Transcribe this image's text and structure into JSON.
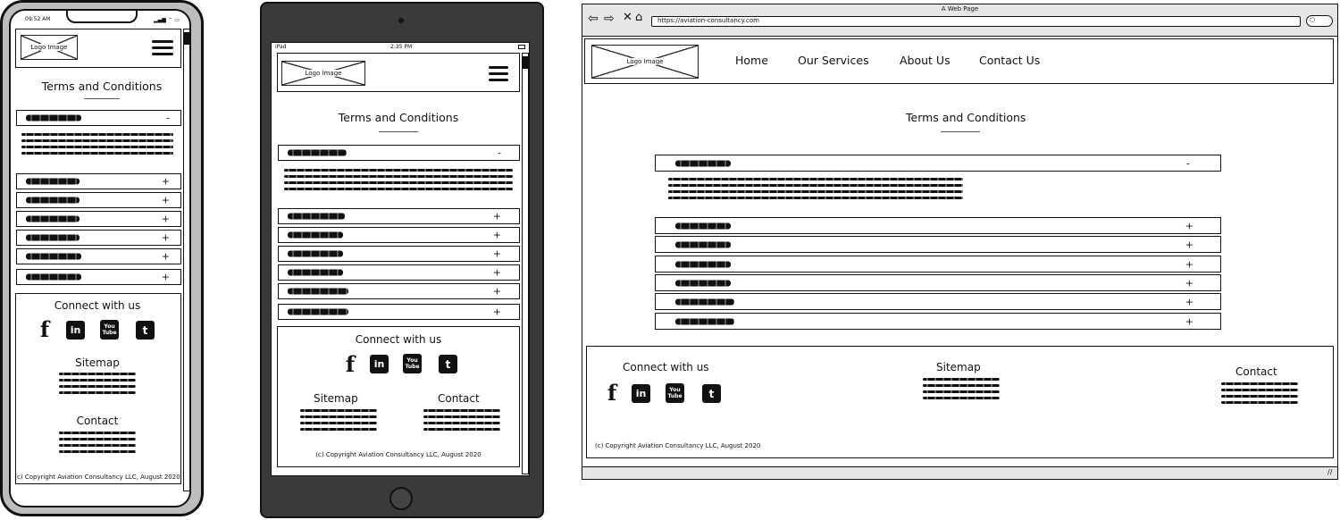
{
  "logo_label": "Logo Image",
  "page_title": "Terms and Conditions",
  "footer": {
    "connect_title": "Connect with us",
    "sitemap_title": "Sitemap",
    "contact_title": "Contact",
    "copyright": "(c) Copyright Aviation Consultancy LLC, August 2020"
  },
  "social_icons": [
    "facebook-icon",
    "linkedin-icon",
    "youtube-icon",
    "twitter-icon"
  ],
  "social_glyphs": {
    "facebook": "f",
    "linkedin": "in",
    "youtube": "You Tube",
    "twitter": "t"
  },
  "accordion": {
    "expanded_marker": "-",
    "collapsed_marker": "+"
  },
  "phone": {
    "time": "09:52 AM"
  },
  "tablet": {
    "carrier": "iPad",
    "time": "2:35 PM"
  },
  "browser": {
    "window_title": "A Web Page",
    "url": "https://aviation-consultancy.com",
    "nav": [
      "Home",
      "Our Services",
      "About Us",
      "Contact Us"
    ]
  }
}
